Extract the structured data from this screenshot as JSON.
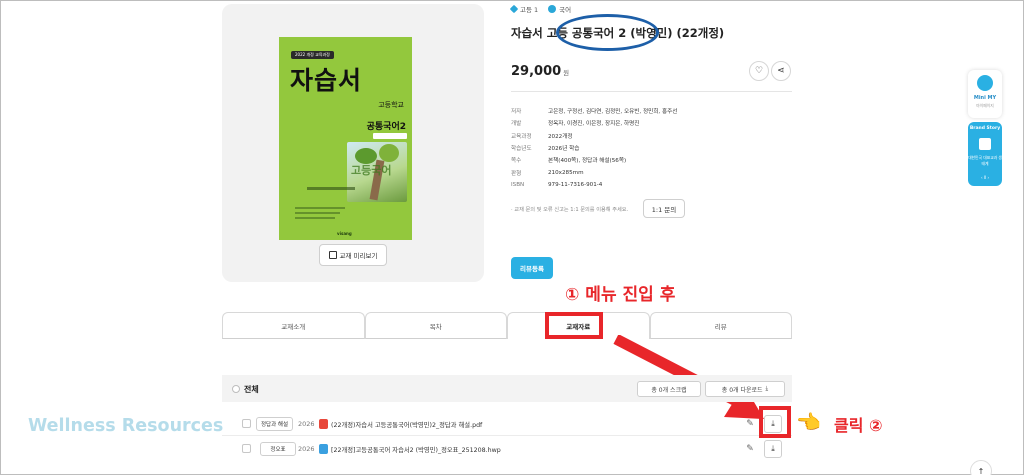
{
  "cover": {
    "badge": "2022 개정 교육과정",
    "title": "자습서",
    "school": "고등학교",
    "subject": "공통국어2",
    "art_word": "고등국어",
    "publisher": "visang"
  },
  "preview_label": "교재 미리보기",
  "grade": {
    "level": "고등 1",
    "subject": "국어"
  },
  "product_title": "자습서 고등 공통국어 2 (박영민) (22개정)",
  "price": {
    "amount": "29,000",
    "unit": "원"
  },
  "specs": [
    {
      "k": "저자",
      "v": "고은정, 구정선, 김다연, 김정민, 오유빈, 정민희, 홍주선"
    },
    {
      "k": "개발",
      "v": "정옥자, 이경진, 이은정, 장지은, 하명진"
    },
    {
      "k": "교육과정",
      "v": "2022개정"
    },
    {
      "k": "학습년도",
      "v": "2026년 학습"
    },
    {
      "k": "쪽수",
      "v": "본책(400쪽), 정답과 해설(56쪽)"
    },
    {
      "k": "판형",
      "v": "210x285mm"
    },
    {
      "k": "ISBN",
      "v": "979-11-7316-901-4"
    }
  ],
  "notice": "· 교재 문의 및 오류 신고는 1:1 문의를 이용해 주세요.",
  "inquiry_label": "1:1 문의",
  "review_label": "리뷰등록",
  "annotation_1": "① 메뉴 진입 후",
  "tabs": [
    "교재소개",
    "목차",
    "교재자료",
    "리뷰"
  ],
  "list": {
    "all_label": "전체",
    "scrap_button": "총 0개 스크랩",
    "download_button": "총 0개 다운로드",
    "rows": [
      {
        "tag": "정답과 해설",
        "year": "2026",
        "file_type": "PDF",
        "filename": "(22개정)자습서 고등공통국어(박영민)2_정답과 해설.pdf"
      },
      {
        "tag": "정오표",
        "year": "2026",
        "file_type": "HWP",
        "filename": "[22개정]고등공통국어 자습서2 (박영민)_정오표_251208.hwp"
      }
    ]
  },
  "annotation_2": "클릭 ②",
  "watermark": "Wellness Resources",
  "sidebar": {
    "mini_my_title": "Mini MY",
    "mini_my_sub": "마이페이지",
    "brand_title": "Brand Story",
    "brand_text": "대한민국 대표교과 생태계",
    "brand_pager": "‹ II ›"
  },
  "colors": {
    "accent": "#2ab0e3",
    "annotation_red": "#e8262a",
    "oval_blue": "#1d5fa8",
    "cover_green": "#93c83d"
  }
}
